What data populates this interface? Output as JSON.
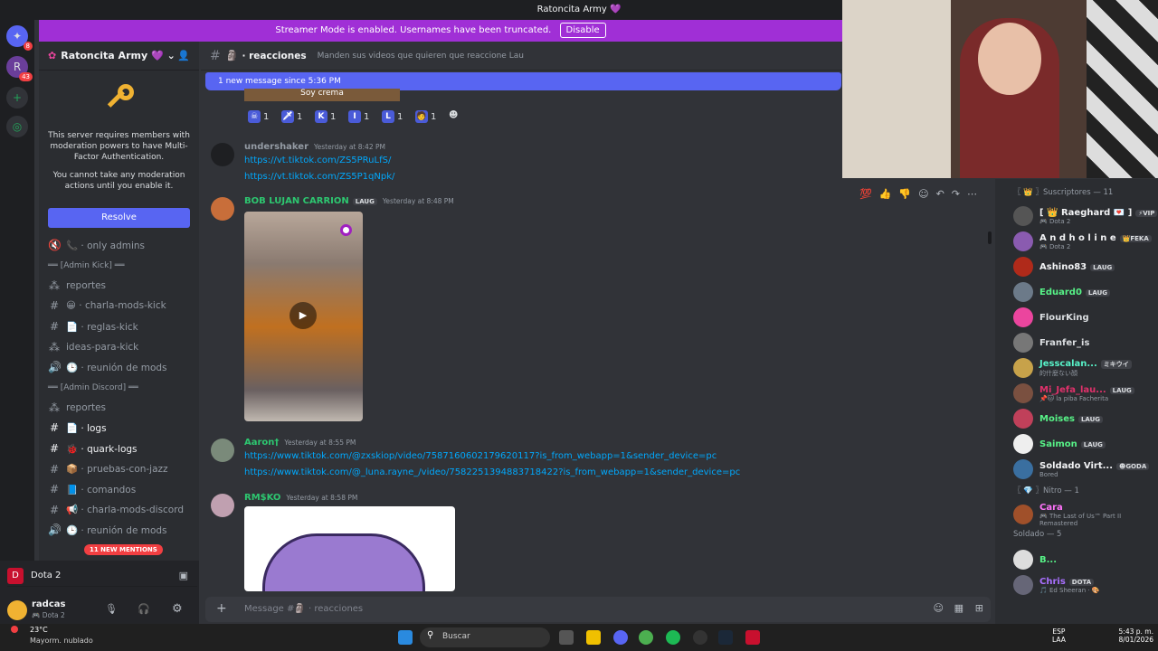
{
  "window": {
    "title": "Ratoncita Army 💜"
  },
  "streamer": {
    "text": "Streamer Mode is enabled. Usernames have been truncated.",
    "disable": "Disable"
  },
  "guild_badges": {
    "dm": "8",
    "server": "43"
  },
  "server": {
    "name": "Ratoncita Army 💜",
    "mfa_text": "This server requires members with moderation powers to have Multi-Factor Authentication.",
    "mfa_text2": "You cannot take any moderation actions until you enable it.",
    "resolve": "Resolve"
  },
  "channels": [
    {
      "icon": "🔇",
      "name": "📞 · only admins",
      "kind": "voice"
    },
    {
      "cat": "══ [Admin Kick] ══"
    },
    {
      "icon": "⁂",
      "name": "reportes"
    },
    {
      "icon": "#",
      "name": "😀 · charla-mods-kick"
    },
    {
      "icon": "#",
      "name": "📄 · reglas-kick"
    },
    {
      "icon": "⁂",
      "name": "ideas-para-kick"
    },
    {
      "icon": "🔊",
      "name": "🕒 · reunión de mods"
    },
    {
      "cat": "══ [Admin Discord] ══"
    },
    {
      "icon": "⁂",
      "name": "reportes"
    },
    {
      "icon": "#",
      "name": "📄 · logs",
      "bold": true
    },
    {
      "icon": "#",
      "name": "🐞 · quark-logs",
      "bold": true
    },
    {
      "icon": "#",
      "name": "📦 · pruebas-con-jazz"
    },
    {
      "icon": "#",
      "name": "📘 · comandos"
    },
    {
      "icon": "#",
      "name": "📢 · charla-mods-discord"
    },
    {
      "icon": "🔊",
      "name": "🕒 · reunión de mods"
    }
  ],
  "mentions": "11 NEW MENTIONS",
  "voice": {
    "name": "Dota 2"
  },
  "user": {
    "name": "radcas",
    "status": "🎮 Dota 2"
  },
  "channel": {
    "name": "· reacciones",
    "topic": "Manden sus videos que quieren que reaccione Lau"
  },
  "newbar": "1 new message since 5:36 PM",
  "prev_caption": "Soy crema",
  "reactions": [
    {
      "icon": "☠",
      "n": "1"
    },
    {
      "icon": "🗡",
      "n": "1"
    },
    {
      "icon": "K",
      "n": "1"
    },
    {
      "icon": "I",
      "n": "1"
    },
    {
      "icon": "L",
      "n": "1"
    },
    {
      "icon": "🧑",
      "n": "1"
    }
  ],
  "messages": [
    {
      "user": "undershaker",
      "time": "Yesterday at 8:42 PM",
      "color": "#949ba4",
      "links": [
        "https://vt.tiktok.com/ZS5PRuLfS/",
        "https://vt.tiktok.com/ZS5P1qNpk/"
      ]
    },
    {
      "user": "BOB LUJAN CARRION",
      "tag": "LAUG",
      "time": "Yesterday at 8:48 PM",
      "color": "#2dc770"
    },
    {
      "user": "Aaron†",
      "time": "Yesterday at 8:55 PM",
      "color": "#2dc770",
      "links": [
        "https://www.tiktok.com/@zxskiop/video/7587160602179620117?is_from_webapp=1&sender_device=pc",
        "https://www.tiktok.com/@_luna.rayne_/video/7582251394883718422?is_from_webapp=1&sender_device=pc"
      ]
    },
    {
      "user": "RM$KO",
      "time": "Yesterday at 8:58 PM",
      "color": "#2dc770"
    }
  ],
  "composer_placeholder": "Message #🗿 · reacciones",
  "members": [
    {
      "head": "〖 👑 〗Suscriptores — 11"
    },
    {
      "name": "[ 👑 Raeghard 💌 ]",
      "badge": "⚡VIP",
      "sub": "🎮 Dota 2",
      "color": "#f2f3f5",
      "av": "#555"
    },
    {
      "name": "A n d h o l i n e",
      "badge": "👑FEKA",
      "sub": "🎮 Dota 2",
      "color": "#f2f3f5",
      "av": "#8a5bb0"
    },
    {
      "name": "Ashino83",
      "badge": "LAUG",
      "color": "#f2f3f5",
      "av": "#b02a1a"
    },
    {
      "name": "Eduard0",
      "badge": "LAUG",
      "color": "#57f287",
      "av": "#6c7a89"
    },
    {
      "name": "FlourKing",
      "color": "#dbdee1",
      "av": "#eb459e"
    },
    {
      "name": "Franfer_is",
      "color": "#dbdee1",
      "av": "#777"
    },
    {
      "name": "Jesscalan...",
      "badge": "ミキウイ",
      "sub": "的什麼ない顔",
      "color": "#57f2c8",
      "av": "#c7a24a"
    },
    {
      "name": "Mi_Jefa_lau...",
      "badge": "LAUG",
      "sub": "📌🐱 la piba Facherita",
      "color": "#e0316b",
      "av": "#7a5040"
    },
    {
      "name": "Moises",
      "badge": "LAUG",
      "color": "#57f287",
      "av": "#c0405a"
    },
    {
      "name": "Saimon",
      "badge": "LAUG",
      "color": "#57f287",
      "av": "#eee"
    },
    {
      "name": "Soldado Virt...",
      "badge": "☻GODA",
      "sub": "Bored",
      "color": "#f2f3f5",
      "av": "#3a6fa0"
    },
    {
      "head": "〖 💎 〗Nitro — 1"
    },
    {
      "name": "Cara",
      "sub": "🎮 The Last of Us™ Part II Remastered",
      "color": "#ff73fa",
      "av": "#a0502a"
    },
    {
      "head": "Soldado — 5"
    },
    {
      "name": "B...",
      "color": "#57f287",
      "av": "#ddd"
    },
    {
      "name": "Chris",
      "badge": "DOTA",
      "sub": "🎵 Ed Sheeran · 🎨",
      "color": "#a970ff",
      "av": "#667"
    }
  ],
  "weather": {
    "temp": "23°C",
    "desc": "Mayorm. nublado"
  },
  "taskbar": {
    "search": "Buscar",
    "lang": "ESP",
    "lang2": "LAA",
    "time": "5:43 p. m.",
    "date": "8/01/2026"
  }
}
